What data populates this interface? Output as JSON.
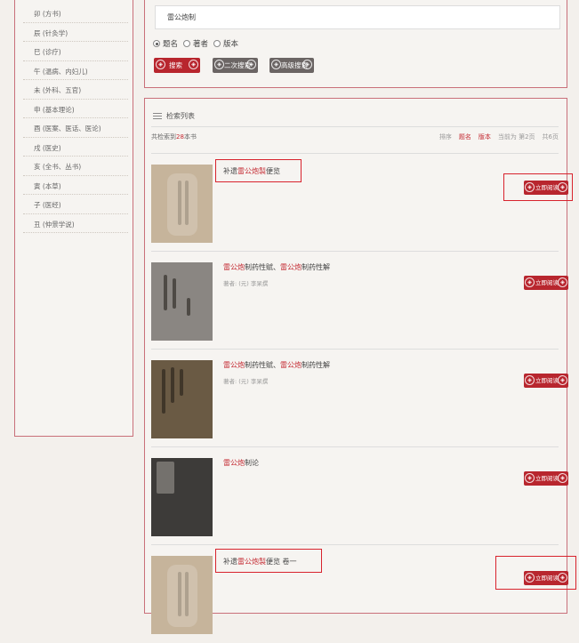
{
  "categories": [
    "卯 (方书)",
    "辰 (针灸学)",
    "巳 (诊疗)",
    "午 (温病、内妇儿)",
    "未 (外科、五官)",
    "申 (基本理论)",
    "酉 (医案、医话、医论)",
    "戌 (医史)",
    "亥 (全书、丛书)",
    "寅 (本草)",
    "子 (医经)",
    "丑 (仲景学说)"
  ],
  "search": {
    "value": "雷公炮制",
    "options": [
      {
        "label": "题名",
        "checked": true
      },
      {
        "label": "著者",
        "checked": false
      },
      {
        "label": "版本",
        "checked": false
      }
    ],
    "buttons": {
      "search": "搜索",
      "second": "二次搜索",
      "advanced": "高级搜索"
    }
  },
  "results": {
    "header": "检索列表",
    "summary_prefix": "共检索到",
    "count": "28",
    "summary_suffix": "本书",
    "sort_label": "排序",
    "sort_title": "题名",
    "sort_edition": "版本",
    "current_page": "当前为 第2页",
    "total_pages": "共6页",
    "read_label": "立即阅读",
    "items": [
      {
        "pre": "补遗",
        "hl": "雷公炮製",
        "post": "便览",
        "hl2": "",
        "post2": "",
        "author": ""
      },
      {
        "pre": "",
        "hl": "雷公炮",
        "post": "制药性赋、",
        "hl2": "雷公炮",
        "post2": "制药性解",
        "author": "著者:  (元) 李杲撰"
      },
      {
        "pre": "",
        "hl": "雷公炮",
        "post": "制药性赋、",
        "hl2": "雷公炮",
        "post2": "制药性解",
        "author": "著者:  (元) 李杲撰"
      },
      {
        "pre": "",
        "hl": "雷公炮",
        "post": "制论",
        "hl2": "",
        "post2": "",
        "author": ""
      },
      {
        "pre": "补遗",
        "hl": "雷公炮製",
        "post": "便览 卷一",
        "hl2": "",
        "post2": "",
        "author": ""
      }
    ]
  },
  "colors": {
    "accent": "#b8262e",
    "highlight_box": "#d8232d",
    "panel_border": "#c9707a"
  }
}
